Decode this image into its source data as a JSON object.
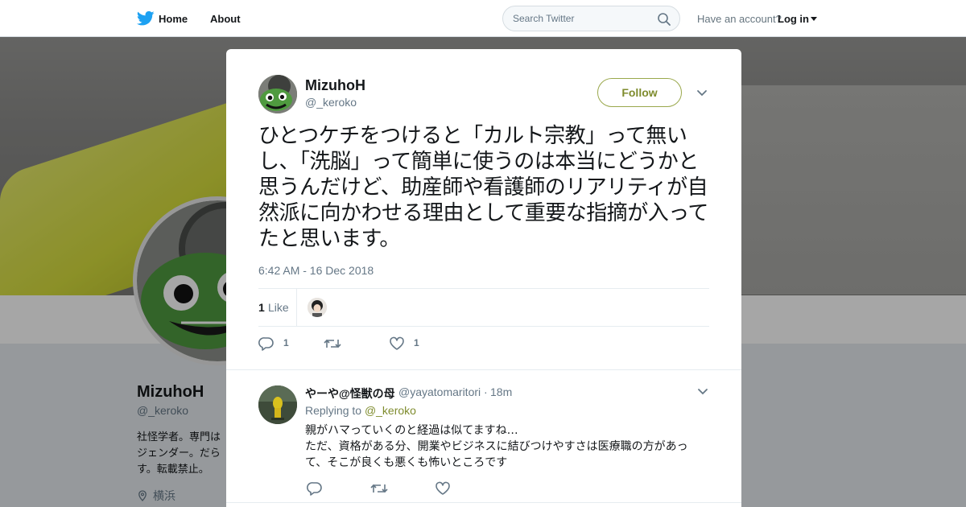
{
  "nav": {
    "home_label": "Home",
    "about_label": "About",
    "search_placeholder": "Search Twitter",
    "have_account_text": "Have an account?",
    "login_label": "Log in"
  },
  "background_profile": {
    "name": "MizuhoH",
    "handle": "@_keroko",
    "bio_lines": [
      "社怪学者。専門は",
      "ジェンダー。だら",
      "す。転載禁止。"
    ],
    "location": "横浜"
  },
  "tweet": {
    "author_name": "MizuhoH",
    "author_handle": "@_keroko",
    "follow_label": "Follow",
    "text": "ひとつケチをつけると「カルト宗教」って無いし、「洗脳」って簡単に使うのは本当にどうかと思うんだけど、助産師や看護師のリアリティが自然派に向かわせる理由として重要な指摘が入ってたと思います。",
    "timestamp": "6:42 AM - 16 Dec 2018",
    "likes_count": "1",
    "likes_label": "Like",
    "reply_count": "1",
    "like_count_action": "1"
  },
  "reply": {
    "author_name": "やーや@怪獣の母",
    "author_handle": "@yayatomaritori",
    "dot": "·",
    "time": "18m",
    "replying_to_label": "Replying to",
    "replying_to_handle": "@_keroko",
    "text_lines": [
      "親がハマっていくのと経過は似てますね…",
      "ただ、資格がある分、開業やビジネスに結びつけやすさは医療職の方があっ",
      "て、そこが良くも悪くも怖いところです"
    ]
  },
  "colors": {
    "brand_blue": "#1da1f2",
    "accent_olive": "#7f8c2e",
    "text_secondary": "#657786"
  }
}
